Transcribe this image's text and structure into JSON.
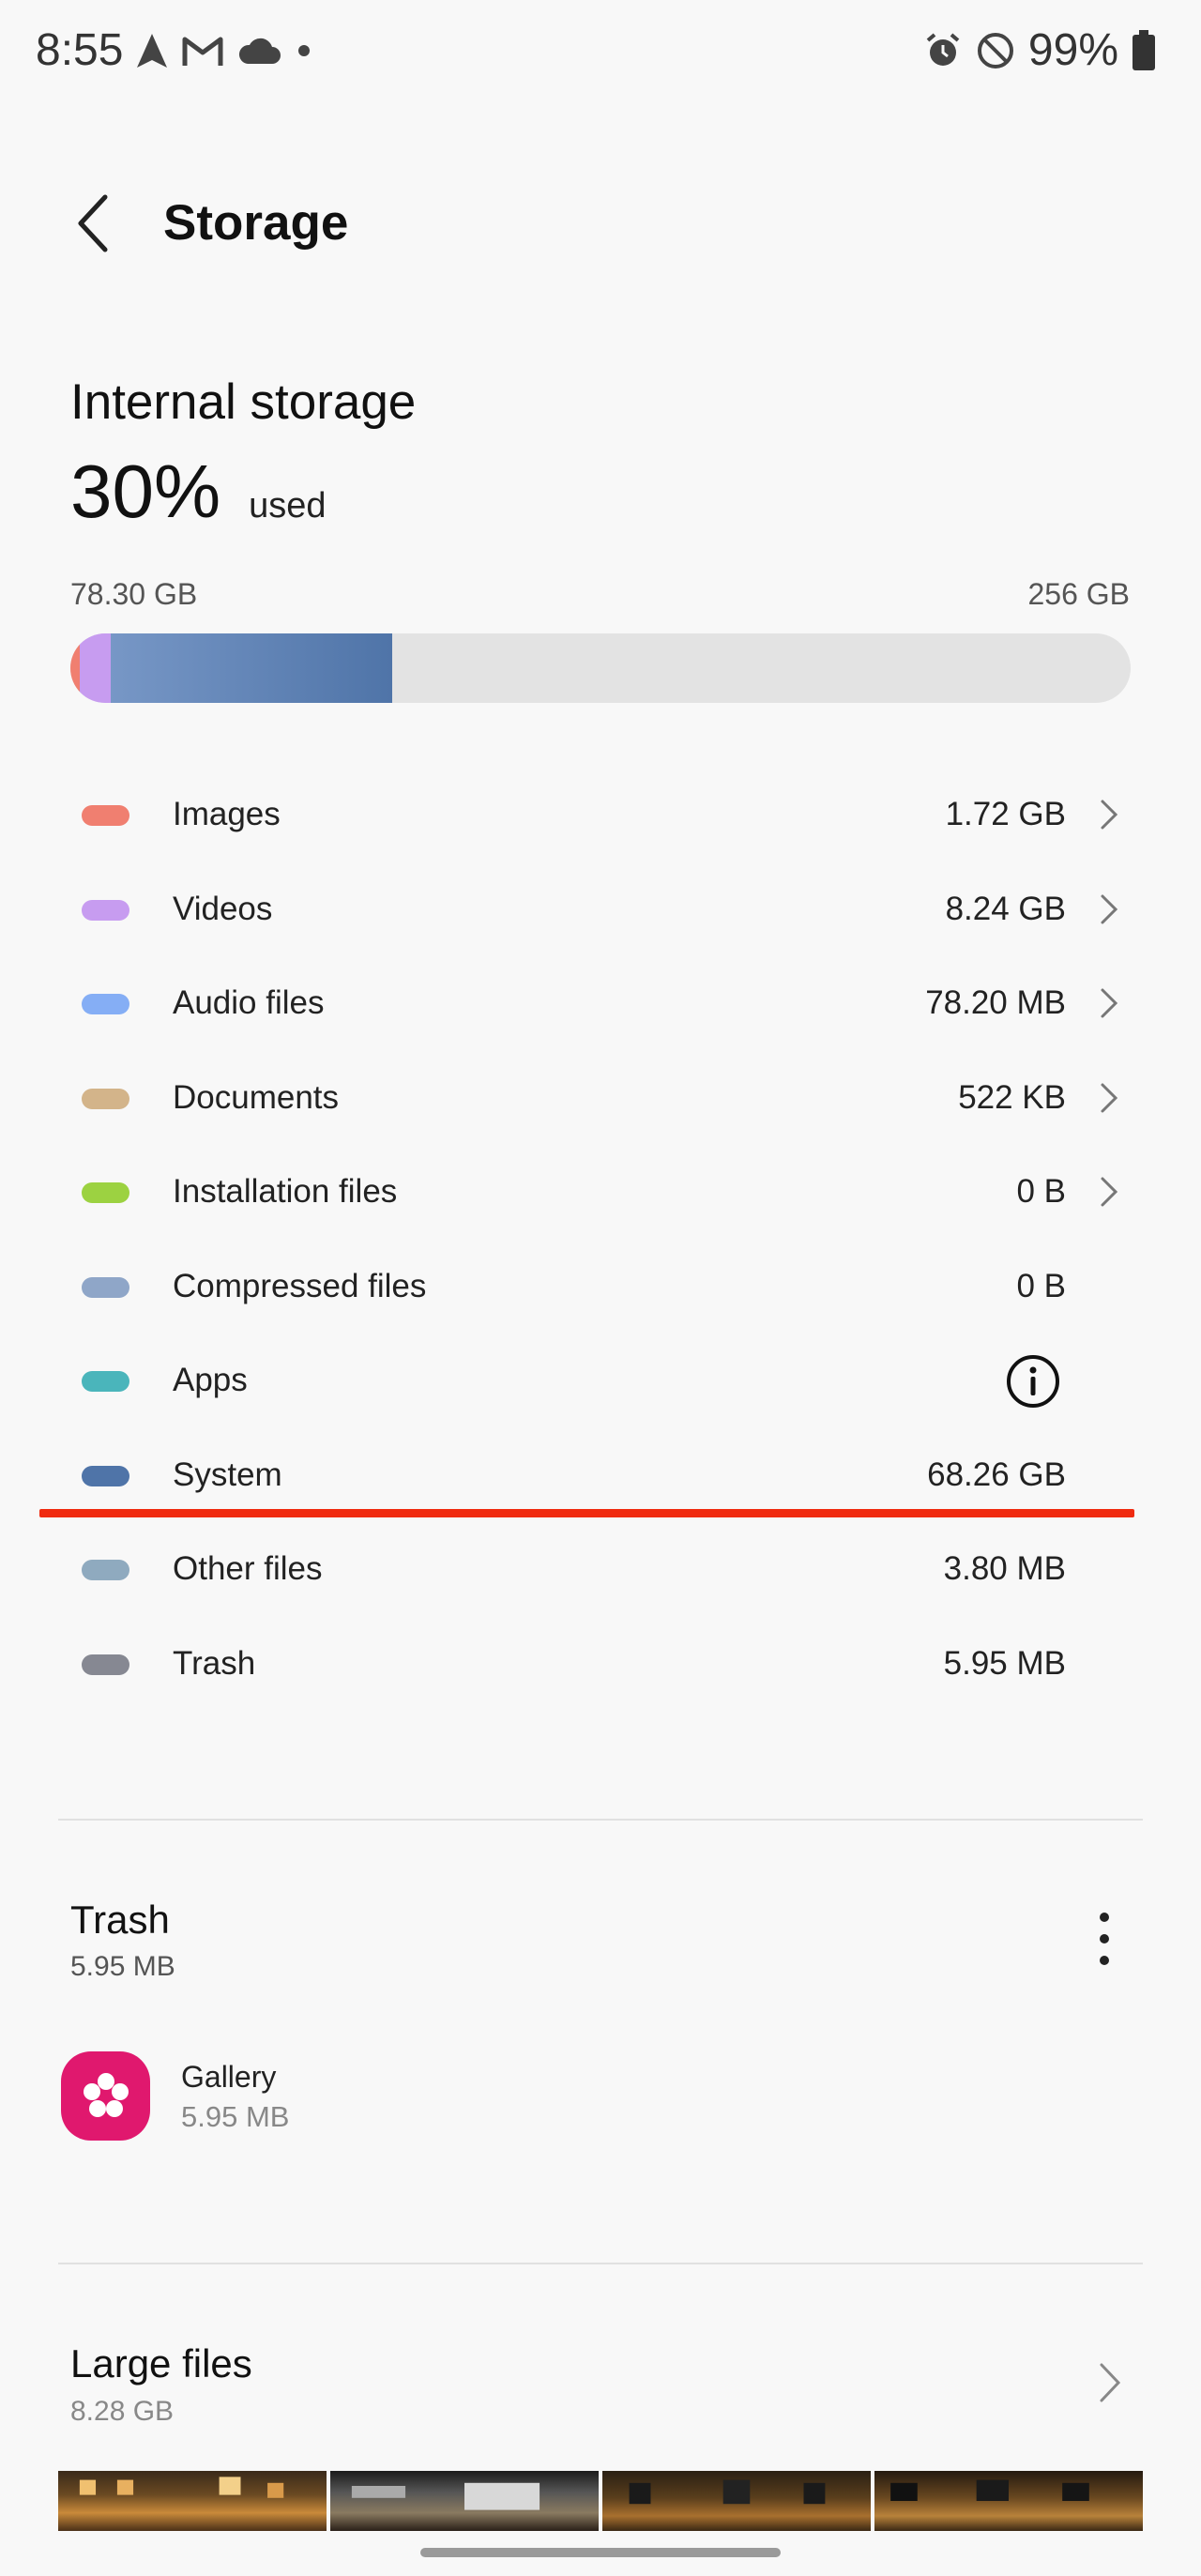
{
  "status_bar": {
    "time": "8:55",
    "battery": "99%",
    "icons_left": [
      "navigation-icon",
      "gmail-icon",
      "cloud-icon",
      "dot-icon"
    ],
    "icons_right": [
      "alarm-icon",
      "do-not-disturb-icon",
      "battery-icon"
    ]
  },
  "header": {
    "title": "Storage"
  },
  "internal": {
    "title": "Internal storage",
    "percent": "30%",
    "percent_suffix": "used",
    "used": "78.30 GB",
    "total": "256 GB",
    "usage_fraction": 0.3
  },
  "colors": {
    "images": "#f07f70",
    "videos": "#c79cf0",
    "audio": "#85aef5",
    "documents": "#d3b48a",
    "installation": "#9cd241",
    "compressed": "#8fa6c8",
    "apps": "#4ab5bb",
    "system": "#4f74a8",
    "other": "#8faabf",
    "trash": "#868892",
    "highlight": "#f02b10",
    "gallery": "#e0186e"
  },
  "categories": [
    {
      "label": "Images",
      "value": "1.72 GB",
      "color_key": "images",
      "chevron": true
    },
    {
      "label": "Videos",
      "value": "8.24 GB",
      "color_key": "videos",
      "chevron": true
    },
    {
      "label": "Audio files",
      "value": "78.20 MB",
      "color_key": "audio",
      "chevron": true
    },
    {
      "label": "Documents",
      "value": "522 KB",
      "color_key": "documents",
      "chevron": true
    },
    {
      "label": "Installation files",
      "value": "0 B",
      "color_key": "installation",
      "chevron": true
    },
    {
      "label": "Compressed files",
      "value": "0 B",
      "color_key": "compressed",
      "chevron": false
    },
    {
      "label": "Apps",
      "value": "",
      "color_key": "apps",
      "chevron": false,
      "info": true
    },
    {
      "label": "System",
      "value": "68.26 GB",
      "color_key": "system",
      "chevron": false
    },
    {
      "label": "Other files",
      "value": "3.80 MB",
      "color_key": "other",
      "chevron": false
    },
    {
      "label": "Trash",
      "value": "5.95 MB",
      "color_key": "trash",
      "chevron": false
    }
  ],
  "trash": {
    "title": "Trash",
    "size": "5.95 MB",
    "items": [
      {
        "name": "Gallery",
        "size": "5.95 MB"
      }
    ]
  },
  "large_files": {
    "title": "Large files",
    "size": "8.28 GB"
  }
}
